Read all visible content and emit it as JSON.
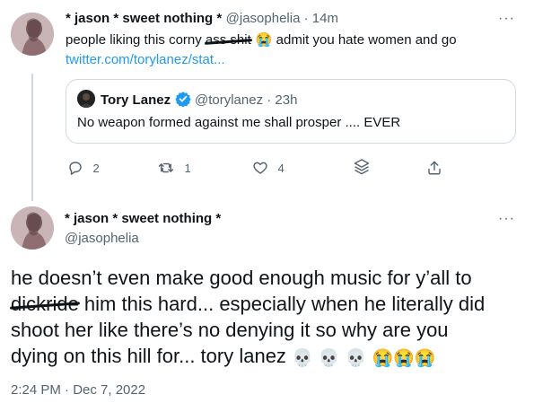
{
  "tweet1": {
    "name": "* jason * sweet nothing *",
    "handle": "@jasophelia",
    "time": "14m",
    "more": "···",
    "text_before": "people liking this corny ",
    "text_struck": "ass shit",
    "text_after": " admit you hate women and go",
    "emoji": "😭",
    "link": "twitter.com/torylanez/stat...",
    "quote": {
      "name": "Tory Lanez",
      "handle": "@torylanez",
      "time": "23h",
      "text": "No weapon formed against me shall prosper .... EVER"
    },
    "actions": {
      "replies": "2",
      "retweets": "1",
      "likes": "4"
    }
  },
  "tweet2": {
    "name": "* jason * sweet nothing *",
    "handle": "@jasophelia",
    "more": "···",
    "line1": "he doesn’t even make good enough music for y’all to",
    "line2_struck": "dickride",
    "line2_after": " him this hard... especially when he literally did",
    "line3": "shoot her like there’s no denying it so why are you",
    "line4": "dying on this hill for... tory lanez ",
    "emojis": [
      "💀",
      "💀",
      "💀",
      "😭",
      "😭",
      "😭"
    ],
    "timestamp": "2:24 PM · Dec 7, 2022"
  },
  "colors": {
    "text": "#0f1419",
    "secondary": "#536471",
    "link": "#1d9bf0",
    "border": "#cfd9de",
    "verified": "#1d9bf0"
  }
}
